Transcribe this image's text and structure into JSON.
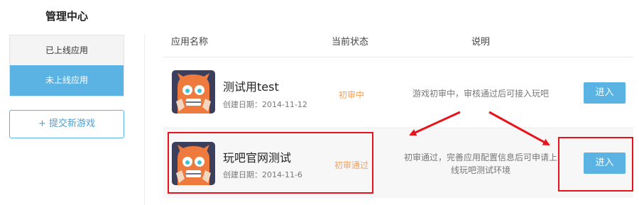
{
  "sidebar": {
    "title": "管理中心",
    "items": [
      {
        "label": "已上线应用"
      },
      {
        "label": "未上线应用"
      }
    ],
    "submit_label": "提交新游戏",
    "submit_icon": "+"
  },
  "table": {
    "headers": {
      "name": "应用名称",
      "status": "当前状态",
      "description": "说明"
    },
    "rows": [
      {
        "name": "测试用test",
        "date": "创建日期：2014-11-12",
        "status": "初审中",
        "description": "游戏初审中，审核通过后可接入玩吧",
        "button": "进入"
      },
      {
        "name": "玩吧官网测试",
        "date": "创建日期：2014-11-6",
        "status": "初审通过",
        "description": "初审通过，完善应用配置信息后可申请上线玩吧测试环境",
        "button": "进入"
      }
    ]
  },
  "colors": {
    "accent": "#5ab3e3",
    "status": "#f5a25a",
    "annotation": "#e8141c"
  }
}
